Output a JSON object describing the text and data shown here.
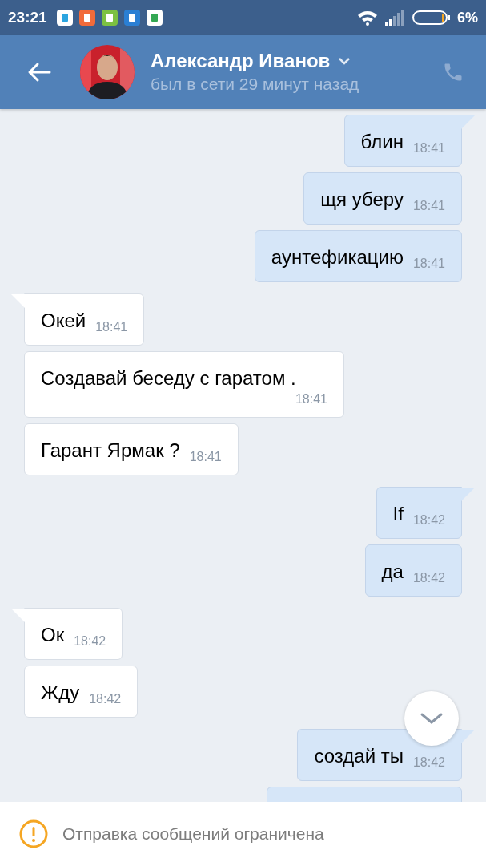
{
  "status_bar": {
    "time": "23:21",
    "battery": "6%"
  },
  "header": {
    "name": "Александр Иванов",
    "status": "был в сети 29 минут назад"
  },
  "messages": [
    {
      "kind": "out",
      "text": "блин",
      "time": "18:41",
      "tail": true
    },
    {
      "kind": "out",
      "text": "щя уберу",
      "time": "18:41",
      "tail": false
    },
    {
      "kind": "out",
      "text": "аунтефикацию",
      "time": "18:41",
      "tail": false
    },
    {
      "kind": "in",
      "text": "Окей",
      "time": "18:41",
      "tail": true
    },
    {
      "kind": "in",
      "text": "Создавай беседу с гаратом .",
      "time": "18:41",
      "tail": false
    },
    {
      "kind": "in",
      "text": "Гарант Ярмак ?",
      "time": "18:41",
      "tail": false
    },
    {
      "kind": "out",
      "text": "If",
      "time": "18:42",
      "tail": true
    },
    {
      "kind": "out",
      "text": "да",
      "time": "18:42",
      "tail": false
    },
    {
      "kind": "in",
      "text": "Ок",
      "time": "18:42",
      "tail": true
    },
    {
      "kind": "in",
      "text": "Жду",
      "time": "18:42",
      "tail": false
    },
    {
      "kind": "out",
      "text": "создай ты",
      "time": "18:42",
      "tail": true
    }
  ],
  "notice": "Отправка сообщений ограничена"
}
